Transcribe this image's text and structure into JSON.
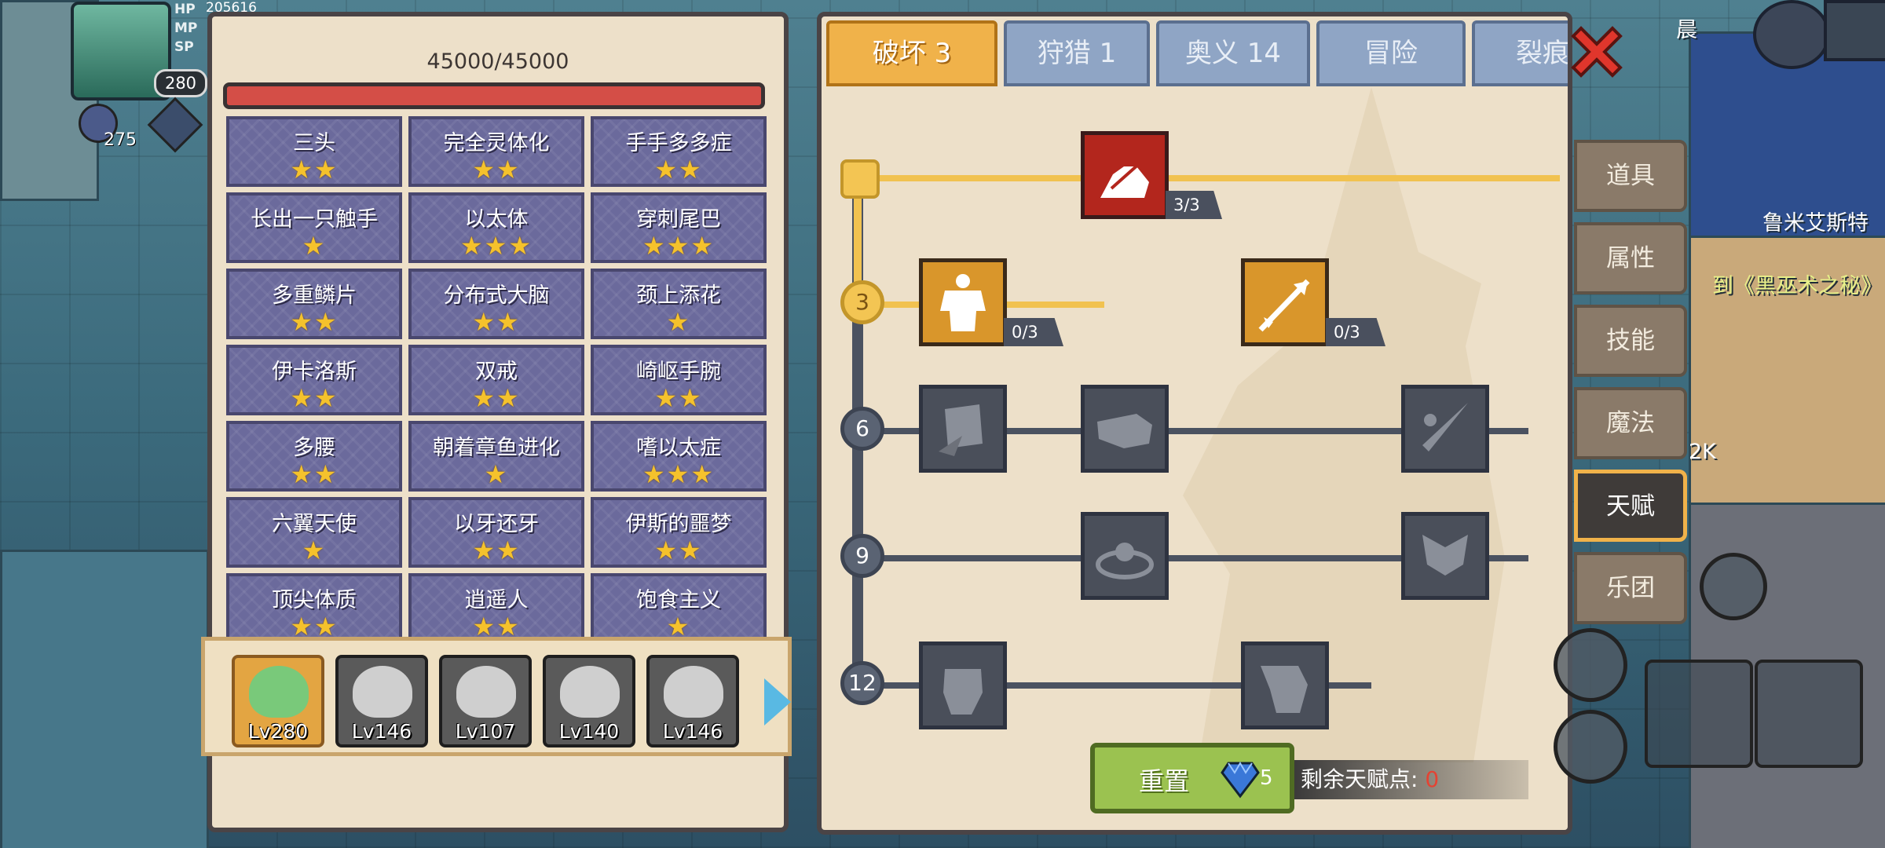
{
  "hud": {
    "hp_label": "HP",
    "mp_label": "MP",
    "sp_label": "SP",
    "hp_value": "205616",
    "level": "280",
    "sub_count": "275"
  },
  "left_panel": {
    "hp_text": "45000/45000",
    "traits": [
      {
        "name": "三头",
        "stars": "★★"
      },
      {
        "name": "完全灵体化",
        "stars": "★★"
      },
      {
        "name": "手手多多症",
        "stars": "★★"
      },
      {
        "name": "长出一只触手",
        "stars": "★"
      },
      {
        "name": "以太体",
        "stars": "★★★"
      },
      {
        "name": "穿刺尾巴",
        "stars": "★★★"
      },
      {
        "name": "多重鳞片",
        "stars": "★★"
      },
      {
        "name": "分布式大脑",
        "stars": "★★"
      },
      {
        "name": "颈上添花",
        "stars": "★"
      },
      {
        "name": "伊卡洛斯",
        "stars": "★★"
      },
      {
        "name": "双戒",
        "stars": "★★"
      },
      {
        "name": "崎岖手腕",
        "stars": "★★"
      },
      {
        "name": "多腰",
        "stars": "★★"
      },
      {
        "name": "朝着章鱼进化",
        "stars": "★"
      },
      {
        "name": "嗜以太症",
        "stars": "★★★"
      },
      {
        "name": "六翼天使",
        "stars": "★"
      },
      {
        "name": "以牙还牙",
        "stars": "★★"
      },
      {
        "name": "伊斯的噩梦",
        "stars": "★★"
      },
      {
        "name": "顶尖体质",
        "stars": "★★"
      },
      {
        "name": "逍遥人",
        "stars": "★★"
      },
      {
        "name": "饱食主义",
        "stars": "★"
      }
    ],
    "characters": [
      {
        "level": "Lv280"
      },
      {
        "level": "Lv146"
      },
      {
        "level": "Lv107"
      },
      {
        "level": "Lv140"
      },
      {
        "level": "Lv146"
      }
    ]
  },
  "talent_panel": {
    "tabs": [
      "破坏 3",
      "狩猎 1",
      "奥义 14",
      "冒险",
      "裂痕"
    ],
    "rows": [
      "",
      "3",
      "6",
      "9",
      "12"
    ],
    "counters": [
      "3/3",
      "0/3",
      "0/3"
    ],
    "reset_label": "重置",
    "reset_cost": "5",
    "remaining_label": "剩余天赋点:",
    "remaining_value": "0"
  },
  "side_menu": [
    "道具",
    "属性",
    "技能",
    "魔法",
    "天赋",
    "乐团"
  ],
  "background_text": {
    "npc_name": "鲁米艾斯特",
    "quest": "到《黑巫术之秘》",
    "value": "2K",
    "time": "晨"
  },
  "colors": {
    "accent": "#f0b24a",
    "trait_bg": "#6b6a9c",
    "star": "#f5c22c",
    "hp_bar": "#d44e47",
    "reset": "#9bc250"
  }
}
